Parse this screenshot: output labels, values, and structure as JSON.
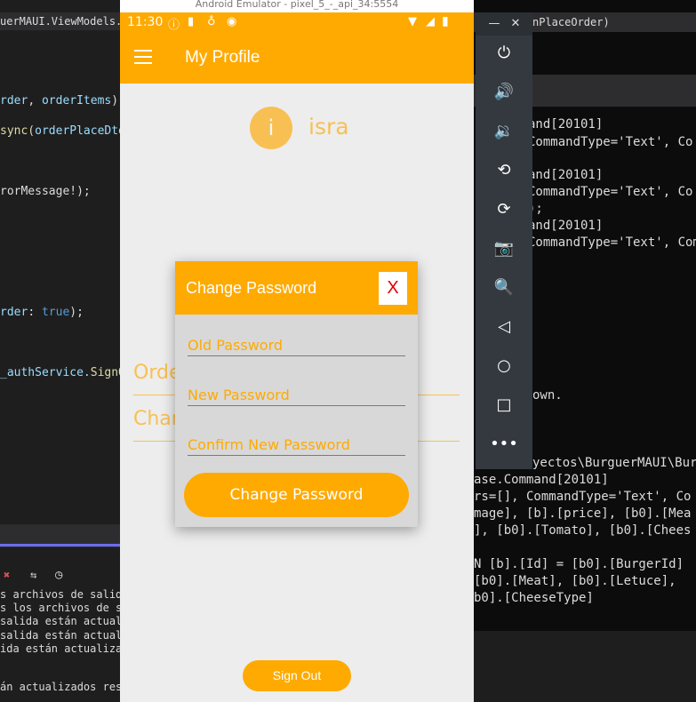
{
  "ide": {
    "tab_title": "uerMAUI.ViewModels.Car",
    "code_lines": [
      {
        "pre": "",
        "a": "rder",
        "mid": ", ",
        "b": "orderItems",
        "post": ");"
      },
      {
        "pre": "",
        "a": "sync(",
        "mid": "",
        "b": "orderPlaceDto",
        "post": ""
      },
      {
        "pre": "",
        "a": "",
        "mid": "",
        "b": "",
        "post": "rorMessage!);"
      },
      {
        "pre": "",
        "a": "rder",
        "mid": ": ",
        "b": "true",
        "post": ");"
      },
      {
        "pre": "",
        "a": "_authService.",
        "mid": "",
        "b": "SignOu",
        "post": ""
      }
    ],
    "output_lines": [
      "s archivos de salida",
      "s los archivos de sa",
      " salida están actual",
      " salida están actual",
      "ida están actualizado",
      "",
      "án actualizados resp"
    ]
  },
  "terminal": {
    "title": "nPlaceOrder)",
    "lines": [
      "and[20101]",
      "CommandType='Text', Co",
      "",
      "and[20101]",
      "CommandType='Text', Co",
      ");",
      "and[20101]",
      "CommandType='Text', Com",
      "own.",
      "yectos\\BurguerMAUI\\Bur",
      "ase.Command[20101]",
      "rs=[], CommandType='Text', Co",
      "mage], [b].[price], [b0].[Mea",
      "], [b0].[Tomato], [b0].[Chees",
      "N [b].[Id] = [b0].[BurgerId]",
      " [b0].[Meat], [b0].[Letuce],",
      "b0].[CheeseType]"
    ]
  },
  "emulator": {
    "title": "Android Emulator - pixel_5_-_api_34:5554"
  },
  "phone": {
    "status_time": "11:30",
    "app_title": "My Profile",
    "avatar_letter": "i",
    "username": "isra",
    "menu": [
      "Orde",
      "Char"
    ],
    "sign_out_label": "Sign Out"
  },
  "dialog": {
    "title": "Change Password",
    "close_label": "X",
    "old_placeholder": "Old Password",
    "new_placeholder": "New Password",
    "confirm_placeholder": "Confirm New Password",
    "submit_label": "Change Password"
  },
  "colors": {
    "accent": "#ffaa00",
    "close_x": "#e00000"
  }
}
